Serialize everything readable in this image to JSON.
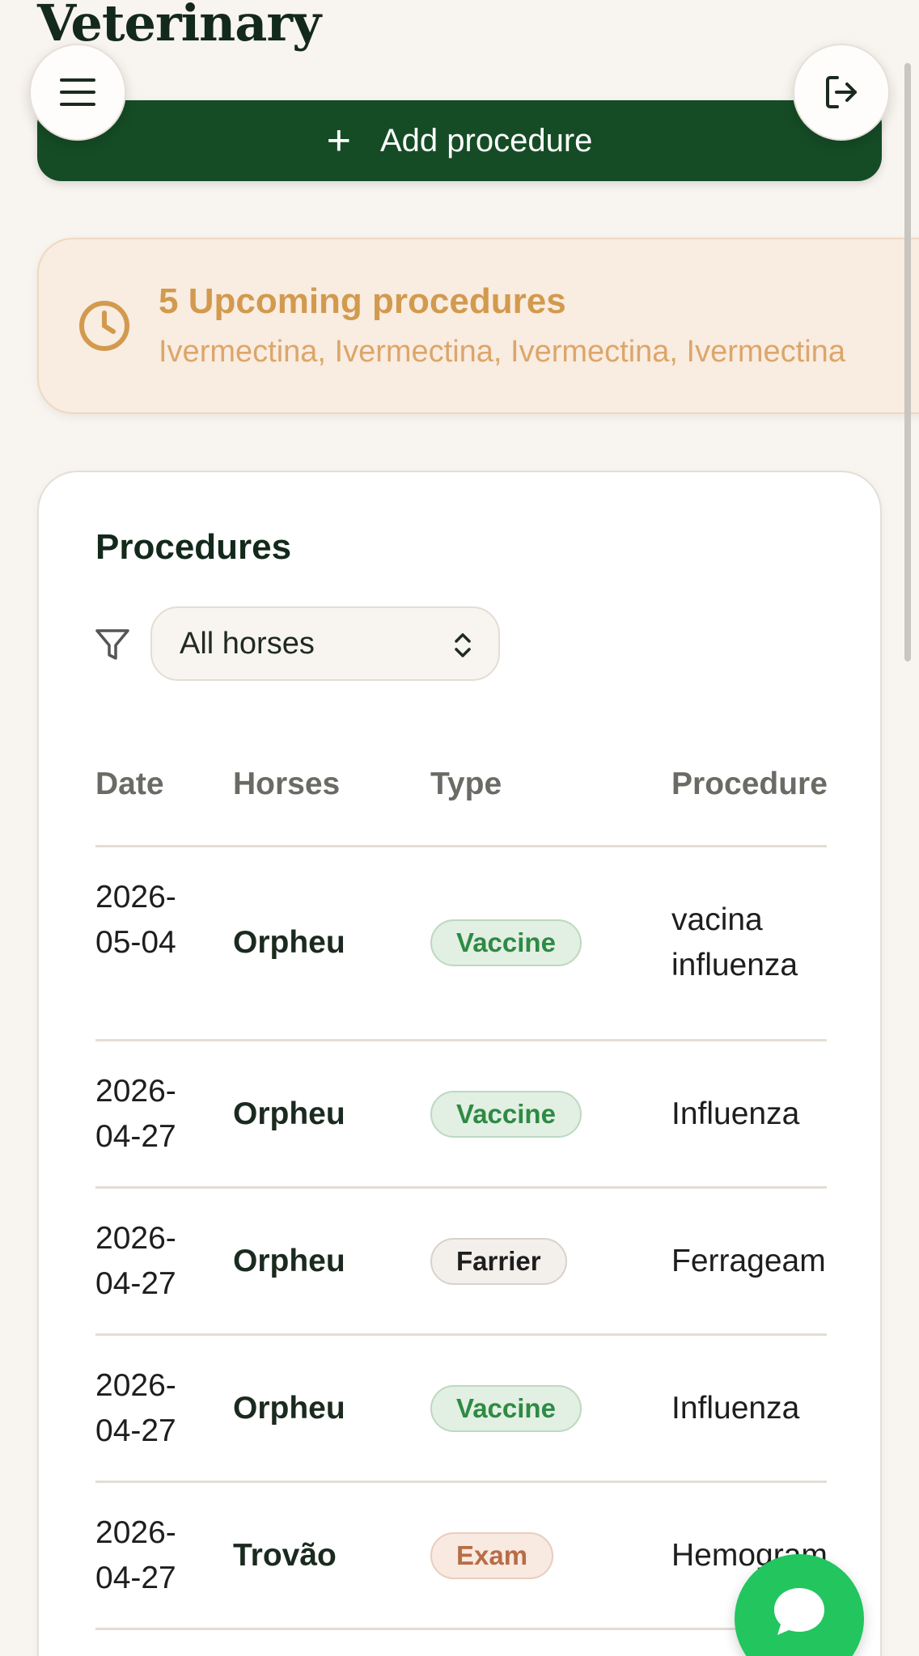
{
  "app": {
    "title": "Veterinary"
  },
  "toolbar": {
    "add_label": "Add procedure",
    "add_icon": "plus-icon"
  },
  "icons": {
    "menu": "hamburger-menu-icon",
    "logout": "logout-icon",
    "chat": "chat-bubble-icon",
    "clock": "clock-icon",
    "filter": "filter-icon"
  },
  "upcoming": {
    "title": "5 Upcoming procedures",
    "list": "Ivermectina, Ivermectina, Ivermectina, Ivermectina"
  },
  "procedures": {
    "title": "Procedures",
    "filter": {
      "selected": "All horses"
    },
    "columns": [
      "Date",
      "Horses",
      "Type",
      "Procedure"
    ],
    "rows": [
      {
        "date": "2026-05-04",
        "horse": "Orpheu",
        "type": "Vaccine",
        "procedure": "vacina influenza"
      },
      {
        "date": "2026-04-27",
        "horse": "Orpheu",
        "type": "Vaccine",
        "procedure": "Influenza"
      },
      {
        "date": "2026-04-27",
        "horse": "Orpheu",
        "type": "Farrier",
        "procedure": "Ferrageam"
      },
      {
        "date": "2026-04-27",
        "horse": "Orpheu",
        "type": "Vaccine",
        "procedure": "Influenza"
      },
      {
        "date": "2026-04-27",
        "horse": "Trovão",
        "type": "Exam",
        "procedure": "Hemogram"
      }
    ]
  },
  "colors": {
    "primary": "#154c26",
    "upcoming_bg": "#f9ece0",
    "upcoming_text": "#d29a4e",
    "vaccine": "#2f8a44",
    "exam": "#b76d46",
    "chat": "#22c55e"
  }
}
